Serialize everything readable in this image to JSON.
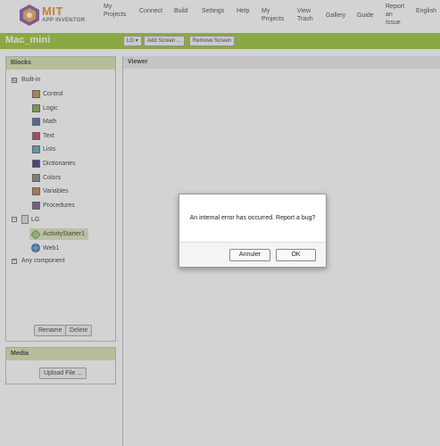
{
  "nav": {
    "logo_title": "MIT",
    "logo_subtitle": "APP INVENTOR",
    "my_projects": "My Projects",
    "connect": "Connect",
    "build": "Build",
    "settings": "Settings",
    "help": "Help",
    "my_projects_link": "My Projects",
    "view_trash": "View Trash",
    "gallery": "Gallery",
    "guide": "Guide",
    "report_issue": "Report an Issue",
    "language": "English"
  },
  "toolbar": {
    "project_name": "Mac_mini",
    "screen_select": "LG ▾",
    "add_screen": "Add Screen ...",
    "remove_screen": "Remove Screen"
  },
  "blocks": {
    "title": "Blocks",
    "builtin_label": "Built-in",
    "builtin_toggle": "⊟",
    "items": [
      {
        "label": "Control",
        "color": "#b5863d"
      },
      {
        "label": "Logic",
        "color": "#77a23b"
      },
      {
        "label": "Math",
        "color": "#3f5b9e"
      },
      {
        "label": "Text",
        "color": "#b02e5c"
      },
      {
        "label": "Lists",
        "color": "#4e9fb8"
      },
      {
        "label": "Dictionaries",
        "color": "#2c2372"
      },
      {
        "label": "Colors",
        "color": "#7a7a7a"
      },
      {
        "label": "Variables",
        "color": "#c4702a"
      },
      {
        "label": "Procedures",
        "color": "#6b4f8d"
      }
    ],
    "screen_label": "LG",
    "components": [
      {
        "label": "ActivityStarter1"
      },
      {
        "label": "Web1"
      }
    ],
    "any_component": "Any component",
    "rename": "Rename",
    "delete": "Delete"
  },
  "media": {
    "title": "Media",
    "upload": "Upload File ..."
  },
  "viewer": {
    "title": "Viewer"
  },
  "dialog": {
    "message": "An internal error has occurred. Report a bug?",
    "cancel": "Annuler",
    "ok": "OK"
  }
}
